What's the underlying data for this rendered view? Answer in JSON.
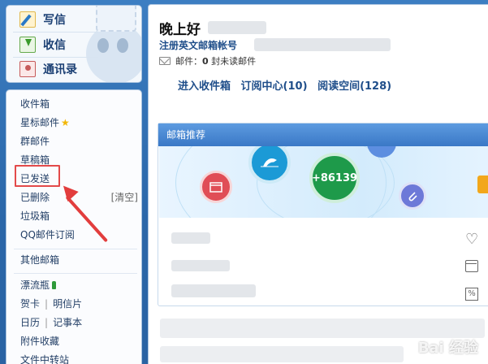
{
  "compose": {
    "write_label": "写信",
    "inbox_label": "收信",
    "contacts_label": "通讯录"
  },
  "folders": {
    "items": [
      {
        "label": "收件箱"
      },
      {
        "label": "星标邮件"
      },
      {
        "label": "群邮件"
      },
      {
        "label": "草稿箱"
      },
      {
        "label": "已发送"
      },
      {
        "label": "已删除"
      },
      {
        "label": "垃圾箱"
      },
      {
        "label": "QQ邮件订阅"
      }
    ],
    "clear_label": "[清空]",
    "other_label": "其他邮箱",
    "bottle_label": "漂流瓶",
    "cards_label": "贺卡",
    "postcard_label": "明信片",
    "calendar_label": "日历",
    "notes_label": "记事本",
    "favorites_label": "附件收藏",
    "transfer_label": "文件中转站"
  },
  "main": {
    "greeting": "晚上好",
    "register_link": "注册英文邮箱帐号",
    "mail_status_prefix": "邮件：",
    "mail_count": "0",
    "mail_status_suffix": "封未读邮件",
    "links": [
      "进入收件箱",
      "订阅中心(10)",
      "阅读空间(128)"
    ],
    "recommend_title": "邮箱推荐",
    "banner_number": "+86139"
  },
  "watermark": "Bai 经验",
  "colors": {
    "highlight": "#e34a4a",
    "link": "#1f4e8a",
    "header_blue": "#3a78c6"
  },
  "icons": [
    "write-icon",
    "inbox-icon",
    "contacts-icon",
    "star-icon",
    "bottle-icon",
    "envelope-icon",
    "heart-icon",
    "calendar-icon",
    "calc-icon"
  ]
}
